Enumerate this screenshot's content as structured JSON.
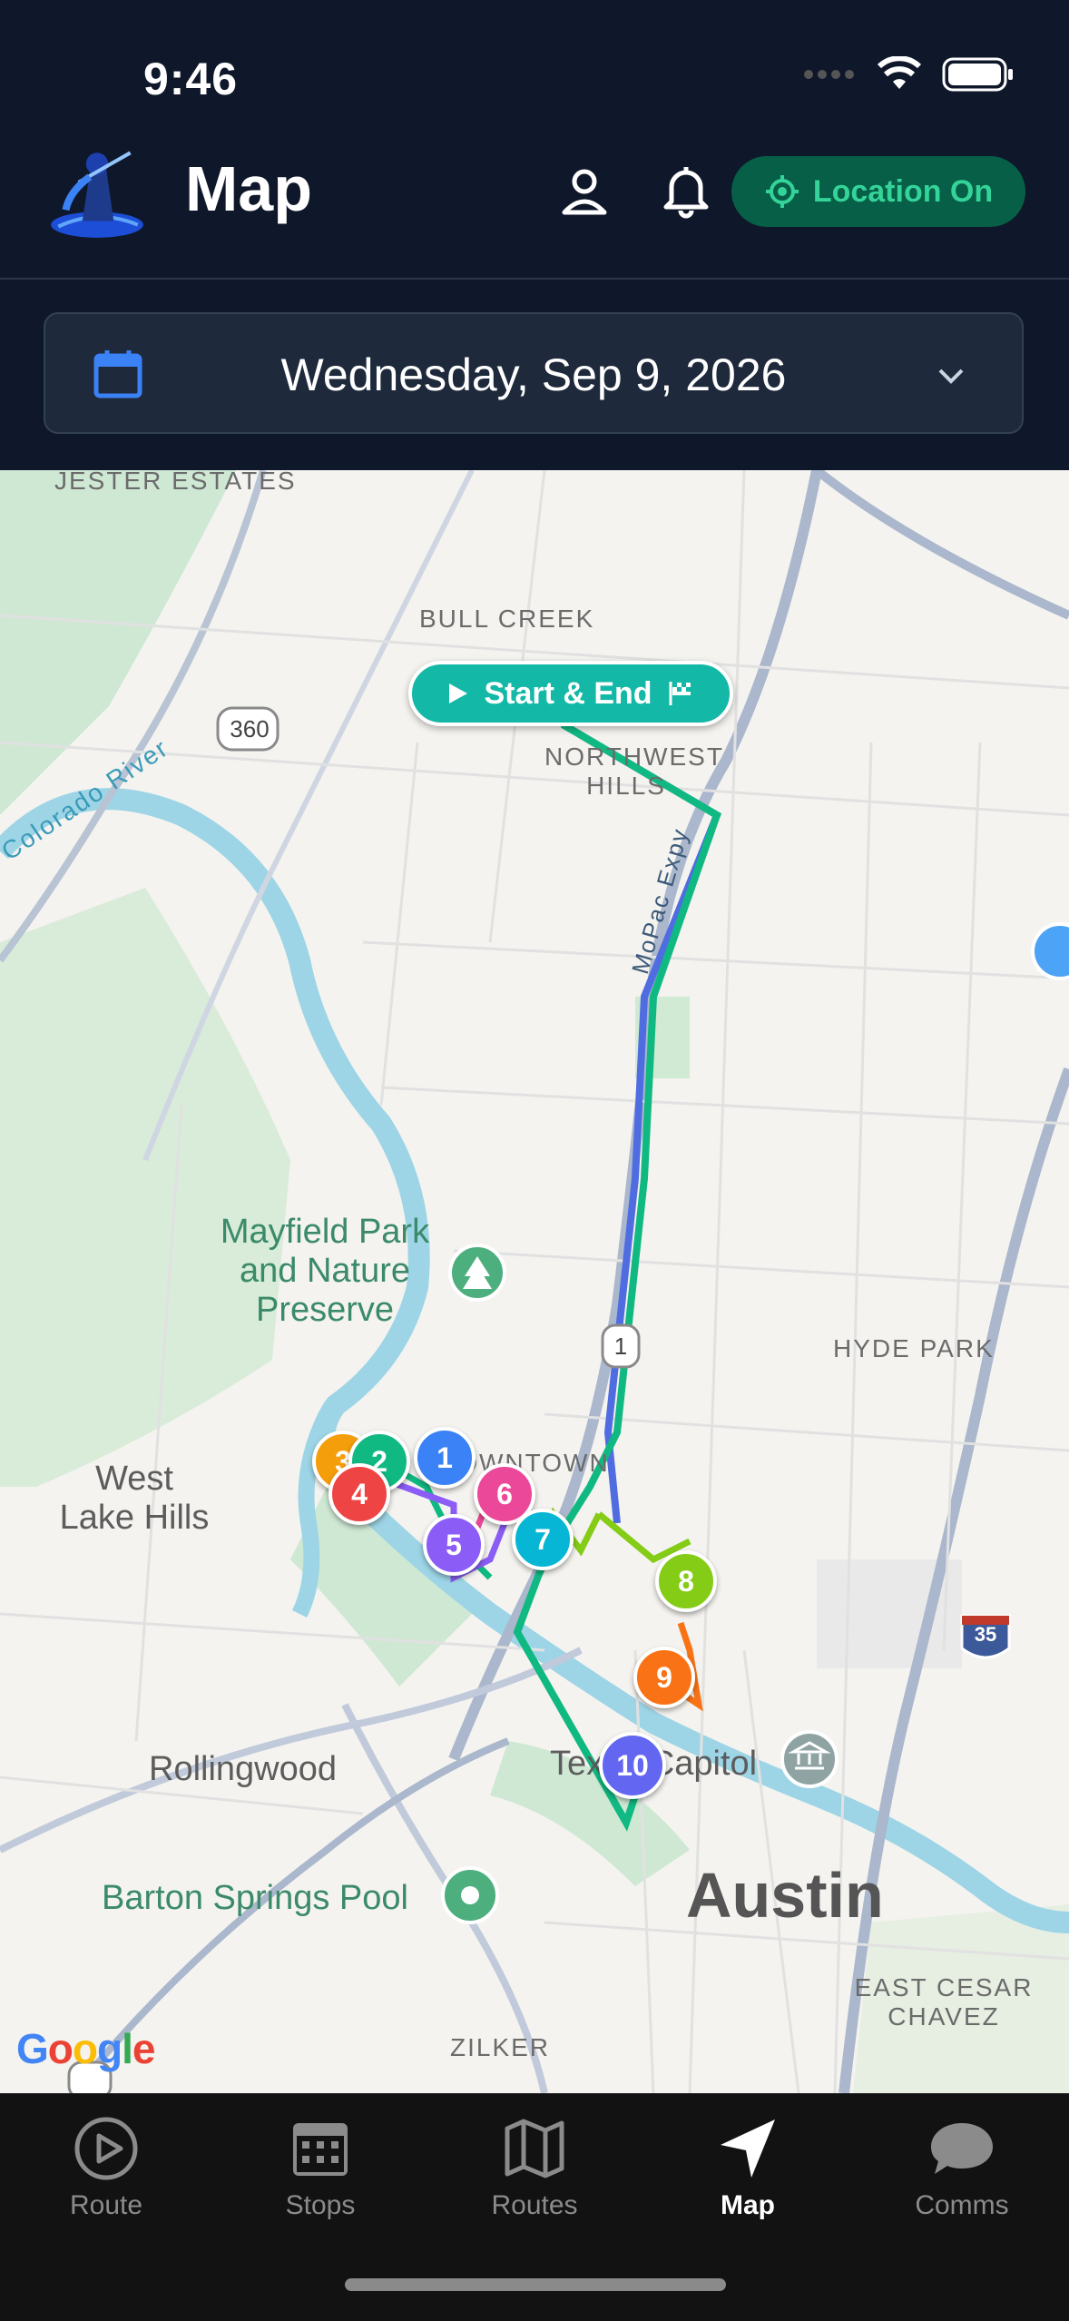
{
  "status": {
    "time": "9:46"
  },
  "header": {
    "title": "Map",
    "location_button": "Location On",
    "icons": [
      "profile-icon",
      "bell-icon",
      "location-crosshair-icon"
    ]
  },
  "date_picker": {
    "value": "Wednesday, Sep 9, 2026"
  },
  "map": {
    "start_end_label": "Start & End",
    "labels": {
      "jester": "JESTER ESTATES",
      "bull_creek": "BULL CREEK",
      "northwest_hills_1": "NORTHWEST",
      "northwest_hills_2": "HILLS",
      "colorado": "Colorado River",
      "mopac": "MoPac Expy",
      "mayfield_1": "Mayfield Park",
      "mayfield_2": "and Nature",
      "mayfield_3": "Preserve",
      "hyde_park": "HYDE PARK",
      "west_lake_1": "West",
      "west_lake_2": "Lake Hills",
      "downtown": "DOWNTOWN",
      "rollingwood": "Rollingwood",
      "texas_capitol": "Texas Capitol",
      "barton": "Barton Springs Pool",
      "austin": "Austin",
      "east_cesar_1": "EAST CESAR",
      "east_cesar_2": "CHAVEZ",
      "zilker": "ZILKER",
      "hwy_360": "360",
      "hwy_1": "1",
      "hwy_35": "35",
      "google": "Google"
    },
    "stops": [
      "1",
      "2",
      "3",
      "4",
      "5",
      "6",
      "7",
      "8",
      "9",
      "10"
    ],
    "colors": {
      "stop_1": "#3b82f6",
      "stop_2": "#10b981",
      "stop_3": "#f59e0b",
      "stop_4": "#ef4444",
      "stop_5": "#8b5cf6",
      "stop_6": "#ec4899",
      "stop_7": "#06b6d4",
      "stop_8": "#84cc16",
      "stop_9": "#f97316",
      "stop_10": "#6366f1"
    }
  },
  "tabs": [
    {
      "label": "Route",
      "icon": "play-circle-icon"
    },
    {
      "label": "Stops",
      "icon": "calendar-grid-icon"
    },
    {
      "label": "Routes",
      "icon": "map-fold-icon"
    },
    {
      "label": "Map",
      "icon": "navigation-arrow-icon",
      "active": true
    },
    {
      "label": "Comms",
      "icon": "chat-bubble-icon"
    }
  ]
}
